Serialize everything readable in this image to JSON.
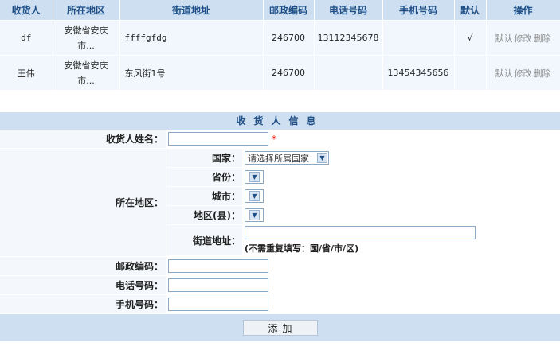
{
  "table": {
    "headers": [
      "收货人",
      "所在地区",
      "街道地址",
      "邮政编码",
      "电话号码",
      "手机号码",
      "默认",
      "操作"
    ],
    "rows": [
      {
        "name": "df",
        "region": "安徽省安庆市...",
        "street": "ffffgfdg",
        "postcode": "246700",
        "phone": "13112345678",
        "mobile": "",
        "default_mark": "√",
        "ops": [
          "默认",
          "修改",
          "删除"
        ]
      },
      {
        "name": "王伟",
        "region": "安徽省安庆市...",
        "street": "东风街1号",
        "postcode": "246700",
        "phone": "",
        "mobile": "13454345656",
        "default_mark": "",
        "ops": [
          "默认",
          "修改",
          "删除"
        ]
      }
    ]
  },
  "form": {
    "title": "收货人信息",
    "name_label": "收货人姓名：",
    "required_mark": "*",
    "region_label": "所在地区：",
    "country_label": "国家：",
    "country_value": "请选择所属国家",
    "province_label": "省份：",
    "city_label": "城市：",
    "district_label": "地区(县)：",
    "street_label": "街道地址：",
    "street_hint": "(不需重复填写：国/省/市/区)",
    "postcode_label": "邮政编码：",
    "phone_label": "电话号码：",
    "mobile_label": "手机号码：",
    "submit_label": "添加"
  },
  "colors": {
    "header_bg": "#cddff1",
    "header_text": "#1f4f86",
    "row_bg": "#f1f7fd",
    "required": "#ee0000"
  }
}
